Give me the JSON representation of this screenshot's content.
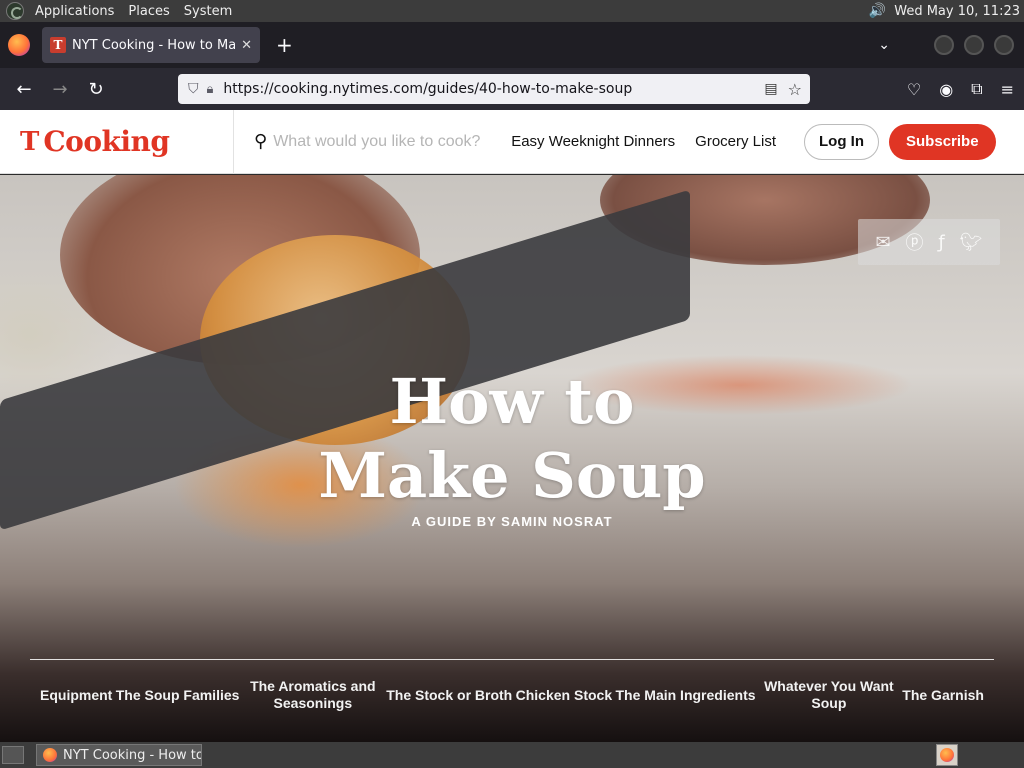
{
  "top_panel": {
    "menus": [
      "Applications",
      "Places",
      "System"
    ],
    "clock": "Wed May 10, 11:23"
  },
  "browser": {
    "tab_title": "NYT Cooking - How to Make Soup",
    "tab_favicon": "T",
    "url": "https://cooking.nytimes.com/guides/40-how-to-make-soup"
  },
  "site_header": {
    "logo_mark": "T",
    "logo_text": "Cooking",
    "search_placeholder": "What would you like to cook?",
    "nav_link_1": "Easy Weeknight Dinners",
    "nav_link_2": "Grocery List",
    "login_label": "Log In",
    "subscribe_label": "Subscribe",
    "accent_color": "#e03524"
  },
  "hero": {
    "title_line_1": "How to",
    "title_line_2": "Make Soup",
    "byline": "A GUIDE BY SAMIN NOSRAT",
    "share_icons": [
      "email-icon",
      "pinterest-icon",
      "facebook-icon",
      "twitter-icon"
    ]
  },
  "guide_nav": {
    "items": [
      "Equipment",
      "The Soup Families",
      "The Aromatics and Seasonings",
      "The Stock or Broth",
      "Chicken Stock",
      "The Main Ingredients",
      "Whatever You Want Soup",
      "The Garnish"
    ]
  },
  "taskbar": {
    "window_label": "NYT Cooking - How to Make Soup"
  }
}
